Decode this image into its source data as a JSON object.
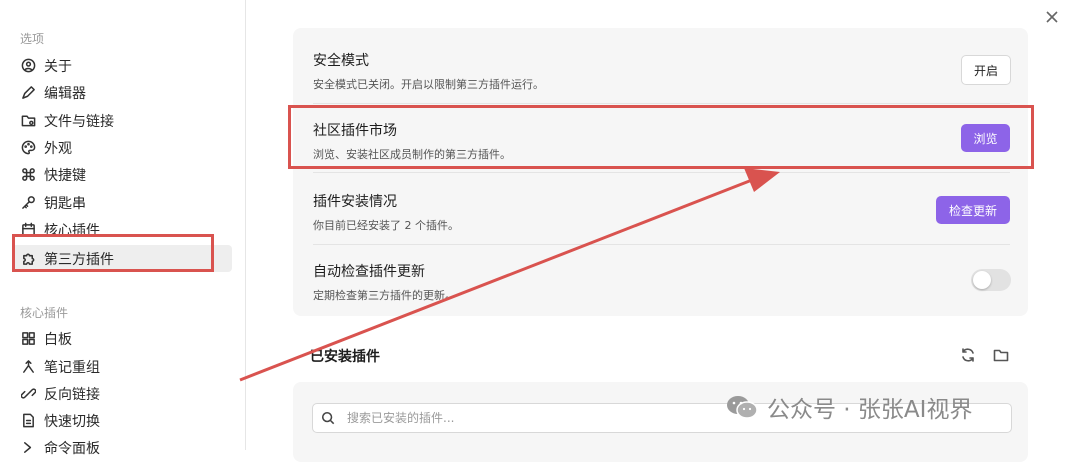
{
  "sidebar": {
    "section_options": "选项",
    "options": [
      {
        "label": "关于",
        "icon": "info-circle-icon"
      },
      {
        "label": "编辑器",
        "icon": "pen-icon"
      },
      {
        "label": "文件与链接",
        "icon": "folder-link-icon"
      },
      {
        "label": "外观",
        "icon": "palette-icon"
      },
      {
        "label": "快捷键",
        "icon": "command-icon"
      },
      {
        "label": "钥匙串",
        "icon": "key-icon"
      },
      {
        "label": "核心插件",
        "icon": "calendar-icon"
      },
      {
        "label": "第三方插件",
        "icon": "puzzle-icon",
        "active": true
      }
    ],
    "section_core": "核心插件",
    "core": [
      {
        "label": "白板",
        "icon": "grid-icon"
      },
      {
        "label": "笔记重组",
        "icon": "merge-icon"
      },
      {
        "label": "反向链接",
        "icon": "backlink-icon"
      },
      {
        "label": "快速切换",
        "icon": "switch-icon"
      },
      {
        "label": "命令面板",
        "icon": "chevron-right-icon"
      }
    ]
  },
  "settings": {
    "safe_mode": {
      "title": "安全模式",
      "desc": "安全模式已关闭。开启以限制第三方插件运行。",
      "button": "开启"
    },
    "market": {
      "title": "社区插件市场",
      "desc": "浏览、安装社区成员制作的第三方插件。",
      "button": "浏览"
    },
    "status": {
      "title": "插件安装情况",
      "desc": "你目前已经安装了 2 个插件。",
      "button": "检查更新"
    },
    "auto_update": {
      "title": "自动检查插件更新",
      "desc": "定期检查第三方插件的更新。",
      "enabled": false
    }
  },
  "installed": {
    "title": "已安装插件",
    "search_placeholder": "搜索已安装的插件..."
  },
  "watermark": "公众号 · 张张AI视界",
  "colors": {
    "accent": "#8d64e8",
    "annotation": "#d9534f"
  }
}
